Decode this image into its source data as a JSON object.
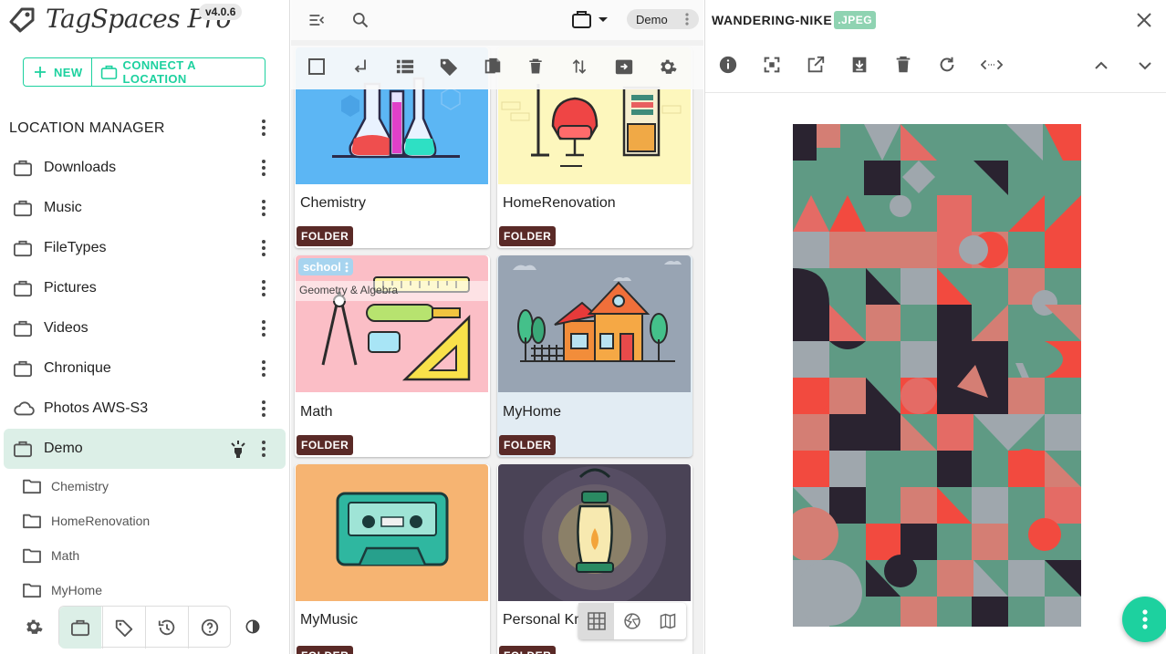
{
  "app": {
    "brand": "TagSpaces Pro",
    "version": "v4.0.6",
    "accent": "#1dd19f"
  },
  "sidebar": {
    "new_label": "NEW",
    "connect_label": "CONNECT A LOCATION",
    "section_title": "LOCATION MANAGER",
    "locations": [
      {
        "label": "Downloads",
        "icon": "briefcase-icon"
      },
      {
        "label": "Music",
        "icon": "briefcase-icon"
      },
      {
        "label": "FileTypes",
        "icon": "briefcase-icon"
      },
      {
        "label": "Pictures",
        "icon": "briefcase-icon"
      },
      {
        "label": "Videos",
        "icon": "briefcase-icon"
      },
      {
        "label": "Chronique",
        "icon": "briefcase-icon"
      },
      {
        "label": "Photos AWS-S3",
        "icon": "cloud-icon"
      },
      {
        "label": "Demo",
        "icon": "briefcase-icon",
        "selected": true
      }
    ],
    "subfolders": [
      {
        "label": "Chemistry"
      },
      {
        "label": "HomeRenovation"
      },
      {
        "label": "Math"
      },
      {
        "label": "MyHome"
      }
    ]
  },
  "main": {
    "location_chip": "Demo",
    "cards": [
      {
        "title": "Chemistry",
        "badge": "FOLDER"
      },
      {
        "title": "HomeRenovation",
        "badge": "FOLDER"
      },
      {
        "title": "Math",
        "badge": "FOLDER",
        "tag": "school",
        "description": "Geometry & Algebra"
      },
      {
        "title": "MyHome",
        "badge": "FOLDER",
        "selected": true
      },
      {
        "title": "MyMusic",
        "badge": "FOLDER"
      },
      {
        "title": "Personal Kn",
        "badge": "FOLDER"
      }
    ]
  },
  "viewer": {
    "file_name": "WANDERING-NIKE",
    "file_ext": ".JPEG"
  }
}
